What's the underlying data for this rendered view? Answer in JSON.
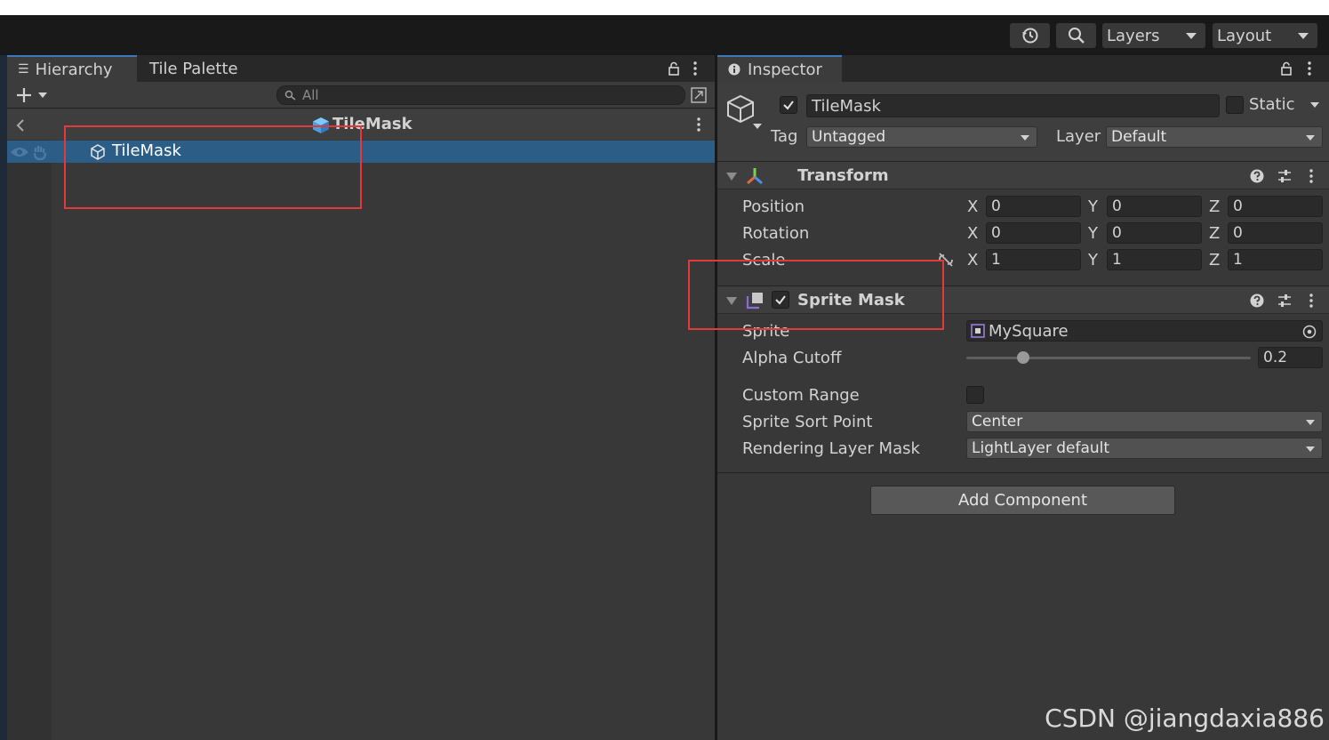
{
  "toolbar": {
    "layers_label": "Layers",
    "layout_label": "Layout"
  },
  "hierarchy": {
    "tabs": [
      {
        "label": "Hierarchy"
      },
      {
        "label": "Tile Palette"
      }
    ],
    "search_placeholder": "All",
    "scene_title": "TileMask",
    "rows": [
      {
        "label": "TileMask"
      }
    ]
  },
  "inspector": {
    "tab_label": "Inspector",
    "object_name": "TileMask",
    "static_label": "Static",
    "tag_label": "Tag",
    "tag_value": "Untagged",
    "layer_label": "Layer",
    "layer_value": "Default",
    "transform": {
      "title": "Transform",
      "rows": [
        {
          "label": "Position",
          "x": "0",
          "y": "0",
          "z": "0"
        },
        {
          "label": "Rotation",
          "x": "0",
          "y": "0",
          "z": "0"
        },
        {
          "label": "Scale",
          "x": "1",
          "y": "1",
          "z": "1"
        }
      ],
      "axis_x": "X",
      "axis_y": "Y",
      "axis_z": "Z"
    },
    "sprite_mask": {
      "title": "Sprite Mask",
      "sprite_label": "Sprite",
      "sprite_value": "MySquare",
      "alpha_label": "Alpha Cutoff",
      "alpha_value": "0.2",
      "alpha_fraction": 0.2,
      "custom_range_label": "Custom Range",
      "sort_point_label": "Sprite Sort Point",
      "sort_point_value": "Center",
      "rendering_layer_label": "Rendering Layer Mask",
      "rendering_layer_value": "LightLayer default"
    },
    "add_component_label": "Add Component"
  },
  "watermark": "CSDN @jiangdaxia886"
}
